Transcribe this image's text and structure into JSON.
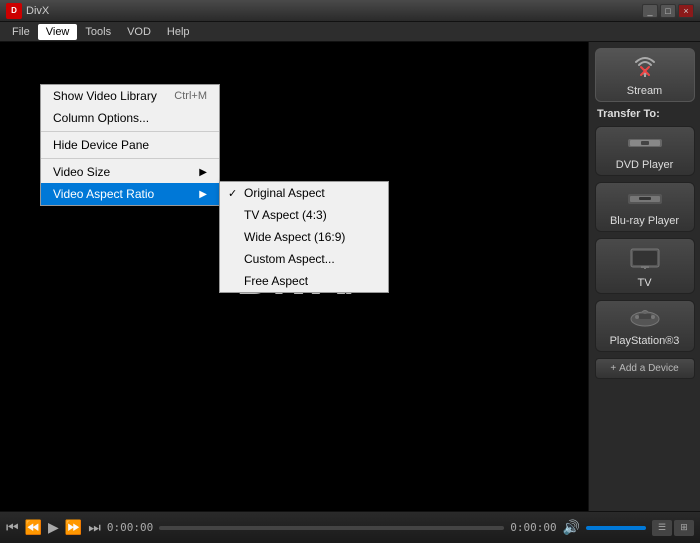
{
  "titlebar": {
    "title": "DivX",
    "controls": [
      "_",
      "□",
      "×"
    ]
  },
  "menubar": {
    "items": [
      "File",
      "View",
      "Tools",
      "VOD",
      "Help"
    ],
    "active": "View"
  },
  "viewmenu": {
    "items": [
      {
        "label": "Show Video Library",
        "shortcut": "Ctrl+M",
        "type": "item"
      },
      {
        "label": "Column Options...",
        "shortcut": "",
        "type": "item"
      },
      {
        "type": "separator"
      },
      {
        "label": "Hide Device Pane",
        "shortcut": "",
        "type": "item"
      },
      {
        "type": "separator"
      },
      {
        "label": "Video Size",
        "shortcut": "",
        "type": "submenu"
      },
      {
        "label": "Video Aspect Ratio",
        "shortcut": "",
        "type": "submenu",
        "highlighted": true
      }
    ]
  },
  "aspectmenu": {
    "items": [
      {
        "label": "Original Aspect",
        "checked": true
      },
      {
        "label": "TV Aspect (4:3)",
        "checked": false
      },
      {
        "label": "Wide Aspect (16:9)",
        "checked": false
      },
      {
        "label": "Custom Aspect...",
        "checked": false
      },
      {
        "label": "Free Aspect",
        "checked": false
      }
    ]
  },
  "rightpanel": {
    "stream_label": "Stream",
    "transfer_label": "Transfer To:",
    "devices": [
      {
        "label": "DVD Player",
        "icon": "💿"
      },
      {
        "label": "Blu-ray Player",
        "icon": "📀"
      },
      {
        "label": "TV",
        "icon": "📺"
      },
      {
        "label": "PlayStation®3",
        "icon": "🎮"
      }
    ],
    "add_device_label": "+ Add a Device"
  },
  "playback": {
    "time_current": "0:00:00",
    "time_total": "0:00:00"
  },
  "logo": {
    "text": "DivX",
    "dot": "."
  }
}
